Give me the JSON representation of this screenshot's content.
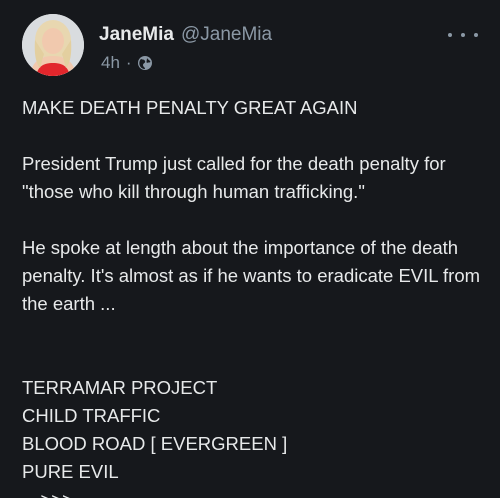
{
  "author": {
    "display_name": "JaneMia",
    "handle": "@JaneMia",
    "time": "4h",
    "separator": "·",
    "visibility_icon": "globe-icon",
    "avatar_icon": "avatar-photo"
  },
  "menu": {
    "more_icon": "more-horizontal-icon"
  },
  "post": {
    "headline": "MAKE DEATH PENALTY GREAT AGAIN",
    "paragraph_1": "President Trump just called for the death penalty for \"those who kill through human trafficking.\"",
    "paragraph_2": "He spoke at length about the importance of the death penalty. It's almost as if he wants to eradicate EVIL from the earth ...",
    "list": [
      "TERRAMAR PROJECT",
      "CHILD TRAFFIC",
      "BLOOD ROAD [ EVERGREEN ]",
      "PURE EVIL",
      "—>>>"
    ]
  },
  "colors": {
    "background": "#16181c",
    "text": "#e7e9ea",
    "muted": "#8b98a5"
  }
}
